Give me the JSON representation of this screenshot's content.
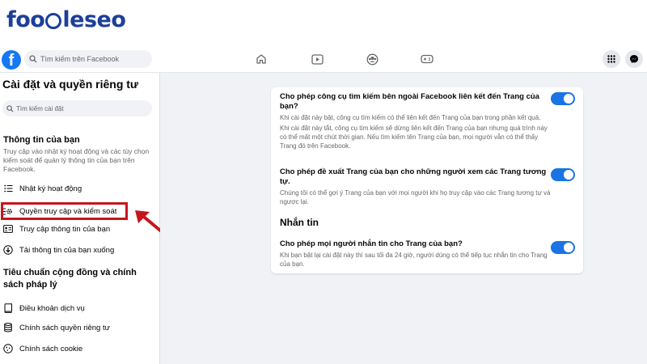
{
  "watermark": {
    "part1": "foo",
    "part2": "le",
    "part3": "seo"
  },
  "topbar": {
    "search_placeholder": "Tìm kiếm trên Facebook",
    "logo_letter": "f",
    "nav_icons": [
      "home-icon",
      "watch-icon",
      "groups-icon",
      "gaming-icon"
    ],
    "right_icons": [
      "menu-grid-icon",
      "messenger-icon"
    ]
  },
  "sidebar": {
    "title": "Cài đặt và quyền riêng tư",
    "search_placeholder": "Tìm kiếm cài đặt",
    "section1": {
      "title": "Thông tin của bạn",
      "description": "Truy cập vào nhật ký hoạt động và các tùy chọn kiểm soát để quản lý thông tin của bạn trên Facebook.",
      "items": [
        {
          "label": "Nhật ký hoạt động",
          "icon": "list-icon"
        },
        {
          "label": "Quyền truy cập và kiểm soát",
          "icon": "gear-list-icon"
        },
        {
          "label": "Truy cập thông tin của bạn",
          "icon": "id-card-icon"
        },
        {
          "label": "Tải thông tin của bạn xuống",
          "icon": "download-icon"
        }
      ]
    },
    "section2": {
      "title": "Tiêu chuẩn cộng đồng và chính sách pháp lý",
      "items": [
        {
          "label": "Điều khoản dịch vụ",
          "icon": "book-icon"
        },
        {
          "label": "Chính sách quyền riêng tư",
          "icon": "database-icon"
        },
        {
          "label": "Chính sách cookie",
          "icon": "cookie-icon"
        }
      ]
    }
  },
  "main": {
    "settings": [
      {
        "title": "Cho phép công cụ tìm kiếm bên ngoài Facebook liên kết đến Trang của bạn?",
        "desc1": "Khi cài đặt này bật, công cụ tìm kiếm có thể liên kết đến Trang của bạn trong phần kết quả.",
        "desc2": "Khi cài đặt này tắt, công cụ tìm kiếm sẽ dừng liên kết đến Trang của bạn nhưng quá trình này có thể mất một chút thời gian. Nếu tìm kiếm tên Trang của bạn, mọi người vẫn có thể thấy Trang đó trên Facebook.",
        "enabled": true
      },
      {
        "title": "Cho phép đề xuất Trang của bạn cho những người xem các Trang tương tự.",
        "desc1": "Chúng tôi có thể gợi ý Trang của bạn với mọi người khi họ truy cập vào các Trang tương tự và ngược lại.",
        "enabled": true
      }
    ],
    "messaging_heading": "Nhắn tin",
    "messaging_setting": {
      "title": "Cho phép mọi người nhắn tin cho Trang của bạn?",
      "desc1": "Khi bạn bật lại cài đặt này thì sau tối đa 24 giờ, người dùng có thể tiếp tục nhắn tin cho Trang của bạn.",
      "enabled": true
    }
  },
  "colors": {
    "accent": "#1b74e4",
    "highlight": "#c5161d",
    "brand": "#1d3f9a"
  }
}
